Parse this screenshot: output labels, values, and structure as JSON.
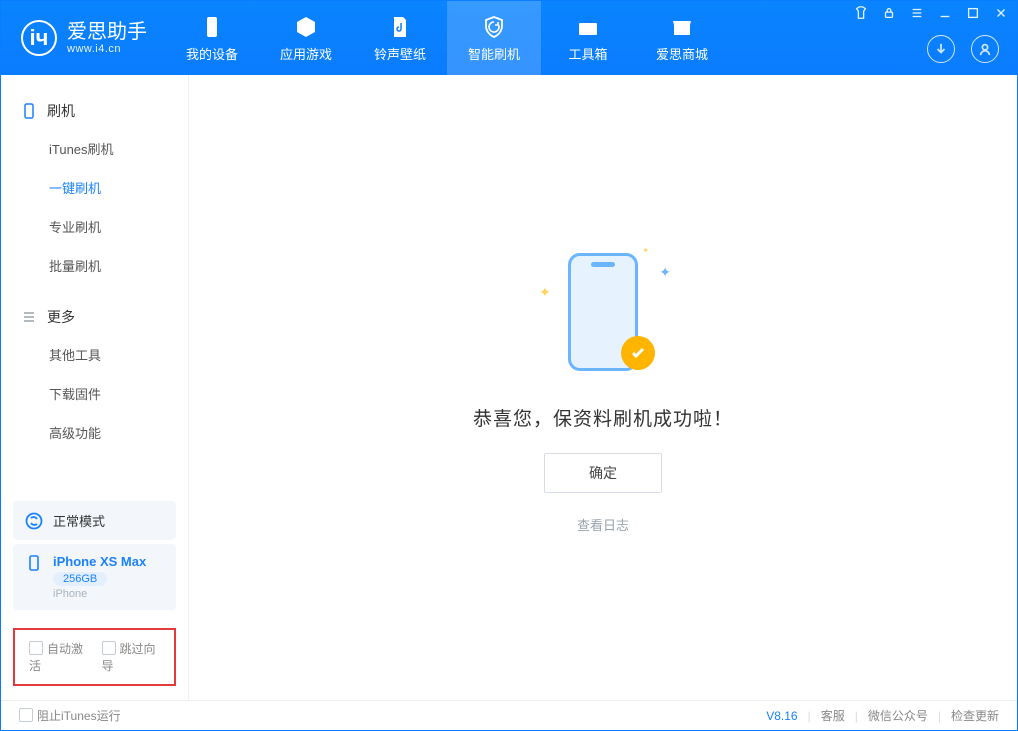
{
  "app": {
    "name": "爱思助手",
    "url": "www.i4.cn"
  },
  "header": {
    "tabs": [
      {
        "label": "我的设备"
      },
      {
        "label": "应用游戏"
      },
      {
        "label": "铃声壁纸"
      },
      {
        "label": "智能刷机"
      },
      {
        "label": "工具箱"
      },
      {
        "label": "爱思商城"
      }
    ]
  },
  "sidebar": {
    "group1": {
      "title": "刷机",
      "items": [
        "iTunes刷机",
        "一键刷机",
        "专业刷机",
        "批量刷机"
      ]
    },
    "group2": {
      "title": "更多",
      "items": [
        "其他工具",
        "下载固件",
        "高级功能"
      ]
    },
    "mode": {
      "label": "正常模式"
    },
    "device": {
      "name": "iPhone XS Max",
      "storage": "256GB",
      "type": "iPhone"
    },
    "checks": {
      "auto_activate": "自动激活",
      "skip_guide": "跳过向导"
    }
  },
  "main": {
    "success": "恭喜您，保资料刷机成功啦！",
    "ok": "确定",
    "view_log": "查看日志"
  },
  "footer": {
    "block_itunes": "阻止iTunes运行",
    "version": "V8.16",
    "links": [
      "客服",
      "微信公众号",
      "检查更新"
    ]
  }
}
